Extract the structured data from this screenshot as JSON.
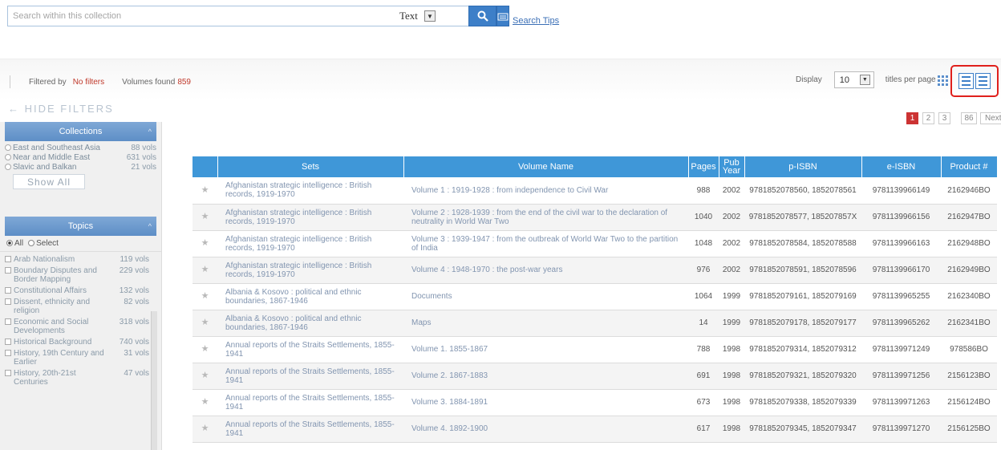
{
  "search": {
    "placeholder": "Search within this collection",
    "type_label": "Text",
    "tips_label": "Search Tips"
  },
  "filters": {
    "filtered_by_label": "Filtered by",
    "filter_value": "No filters",
    "volumes_found_label": "Volumes found",
    "volumes_found_count": "859",
    "hide_label": "HIDE FILTERS"
  },
  "display": {
    "label": "Display",
    "per_page_value": "10",
    "per_page_suffix": "titles per page"
  },
  "pagination": {
    "pages": [
      "1",
      "2",
      "3"
    ],
    "active_page": "1",
    "last_page": "86",
    "next_label": "Next →"
  },
  "sidebar": {
    "collections_title": "Collections",
    "collections": [
      {
        "name": "East and Southeast Asia",
        "count": "88 vols"
      },
      {
        "name": "Near and Middle East",
        "count": "631 vols"
      },
      {
        "name": "Slavic and Balkan",
        "count": "21 vols"
      }
    ],
    "show_all_label": "Show All",
    "topics_title": "Topics",
    "topic_mode_all": "All",
    "topic_mode_select": "Select",
    "topics": [
      {
        "name": "Arab Nationalism",
        "count": "119 vols"
      },
      {
        "name": "Boundary Disputes and Border Mapping",
        "count": "229 vols"
      },
      {
        "name": "Constitutional Affairs",
        "count": "132 vols"
      },
      {
        "name": "Dissent, ethnicity and religion",
        "count": "82 vols"
      },
      {
        "name": "Economic and Social Developments",
        "count": "318 vols"
      },
      {
        "name": "Historical Background",
        "count": "740 vols"
      },
      {
        "name": "History, 19th Century and Earlier",
        "count": "31 vols"
      },
      {
        "name": "History, 20th-21st Centuries",
        "count": "47 vols"
      }
    ]
  },
  "table": {
    "headers": [
      "Sets",
      "Volume Name",
      "Pages",
      "Pub Year",
      "p-ISBN",
      "e-ISBN",
      "Product #"
    ],
    "rows": [
      {
        "set": "Afghanistan strategic intelligence : British records, 1919-1970",
        "volume": "Volume 1 : 1919-1928 : from independence to Civil War",
        "pages": "988",
        "year": "2002",
        "pisbn": "9781852078560, 1852078561",
        "eisbn": "9781139966149",
        "product": "2162946BO"
      },
      {
        "set": "Afghanistan strategic intelligence : British records, 1919-1970",
        "volume": "Volume 2 : 1928-1939 : from the end of the civil war to the declaration of neutrality in World War Two",
        "pages": "1040",
        "year": "2002",
        "pisbn": "9781852078577, 185207857X",
        "eisbn": "9781139966156",
        "product": "2162947BO"
      },
      {
        "set": "Afghanistan strategic intelligence : British records, 1919-1970",
        "volume": "Volume 3 : 1939-1947 : from the outbreak of World War Two to the partition of India",
        "pages": "1048",
        "year": "2002",
        "pisbn": "9781852078584, 1852078588",
        "eisbn": "9781139966163",
        "product": "2162948BO"
      },
      {
        "set": "Afghanistan strategic intelligence : British records, 1919-1970",
        "volume": "Volume 4 : 1948-1970 : the post-war years",
        "pages": "976",
        "year": "2002",
        "pisbn": "9781852078591, 1852078596",
        "eisbn": "9781139966170",
        "product": "2162949BO"
      },
      {
        "set": "Albania & Kosovo : political and ethnic boundaries, 1867-1946",
        "volume": "Documents",
        "pages": "1064",
        "year": "1999",
        "pisbn": "9781852079161, 1852079169",
        "eisbn": "9781139965255",
        "product": "2162340BO"
      },
      {
        "set": "Albania & Kosovo : political and ethnic boundaries, 1867-1946",
        "volume": "Maps",
        "pages": "14",
        "year": "1999",
        "pisbn": "9781852079178, 1852079177",
        "eisbn": "9781139965262",
        "product": "2162341BO"
      },
      {
        "set": "Annual reports of the Straits Settlements, 1855-1941",
        "volume": "Volume 1. 1855-1867",
        "pages": "788",
        "year": "1998",
        "pisbn": "9781852079314, 1852079312",
        "eisbn": "9781139971249",
        "product": "978586BO"
      },
      {
        "set": "Annual reports of the Straits Settlements, 1855-1941",
        "volume": "Volume 2. 1867-1883",
        "pages": "691",
        "year": "1998",
        "pisbn": "9781852079321, 1852079320",
        "eisbn": "9781139971256",
        "product": "2156123BO"
      },
      {
        "set": "Annual reports of the Straits Settlements, 1855-1941",
        "volume": "Volume 3. 1884-1891",
        "pages": "673",
        "year": "1998",
        "pisbn": "9781852079338, 1852079339",
        "eisbn": "9781139971263",
        "product": "2156124BO"
      },
      {
        "set": "Annual reports of the Straits Settlements, 1855-1941",
        "volume": "Volume 4. 1892-1900",
        "pages": "617",
        "year": "1998",
        "pisbn": "9781852079345, 1852079347",
        "eisbn": "9781139971270",
        "product": "2156125BO"
      }
    ]
  },
  "icons": {
    "search": "magnifier-icon",
    "keyboard": "keyboard-icon",
    "star": "star-icon",
    "grid_view": "grid-view-icon",
    "list_view": "list-view-icon"
  },
  "colors": {
    "accent": "#3f97d8",
    "highlight": "#e0201c",
    "active_page": "#cc3333",
    "link": "#3b6fb6"
  }
}
